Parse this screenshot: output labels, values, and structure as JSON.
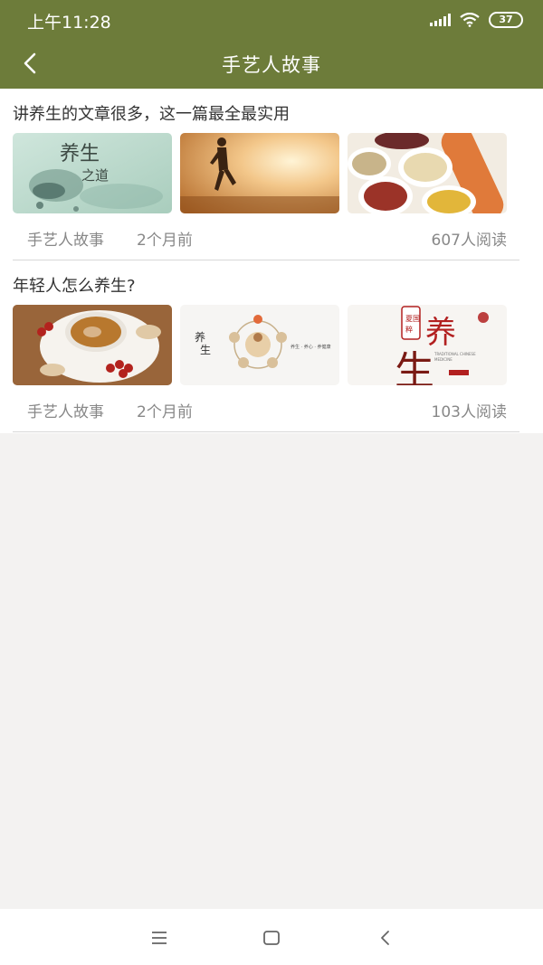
{
  "status_bar": {
    "time": "上午11:28",
    "battery": "37",
    "icons": [
      "signal-icon",
      "wifi-icon",
      "battery-icon"
    ]
  },
  "header": {
    "title": "手艺人故事",
    "back_icon": "chevron-left-icon",
    "background_color": "#6d7c3a"
  },
  "articles": [
    {
      "title": "讲养生的文章很多，这一篇最全最实用",
      "author": "手艺人故事",
      "time": "2个月前",
      "reads": "607人阅读",
      "thumbnail_logo_text": "养生之道"
    },
    {
      "title": "年轻人怎么养生?",
      "author": "手艺人故事",
      "time": "2个月前",
      "reads": "103人阅读",
      "thumbnail_logo_text": "养生"
    }
  ],
  "system_nav": {
    "icons": [
      "menu-icon",
      "home-square-icon",
      "back-triangle-icon"
    ]
  }
}
